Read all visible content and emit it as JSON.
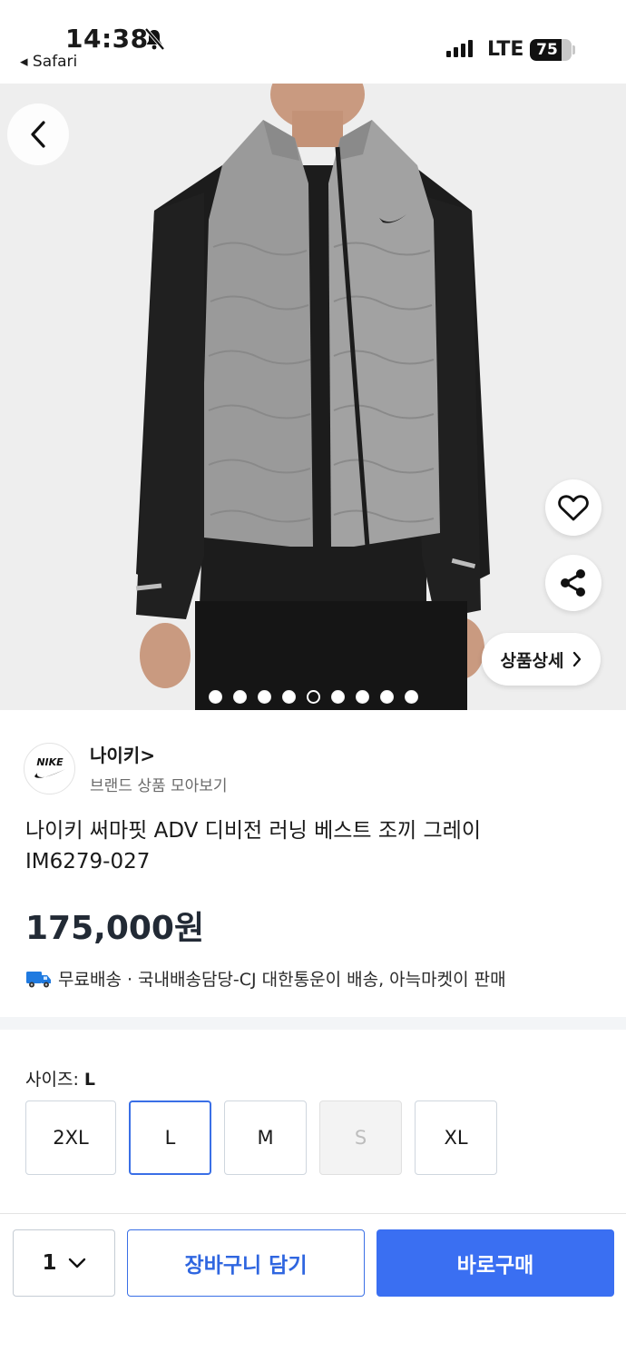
{
  "status_bar": {
    "time": "14:38",
    "back_app": "◂ Safari",
    "network": "LTE",
    "battery": "75",
    "battery_level": 0.75
  },
  "hero": {
    "image_count": 9,
    "active_index": 4,
    "detail_label": "상품상세",
    "icons": {
      "back": "chevron-left-icon",
      "like": "heart-icon",
      "share": "share-icon"
    }
  },
  "brand": {
    "name": "나이키>",
    "subtitle": "브랜드 상품 모아보기",
    "logo_text": "NIKE"
  },
  "product": {
    "title_line1": "나이키 써마핏 ADV 디비전 러닝 베스트 조끼 그레이",
    "title_line2": "IM6279-027",
    "price": "175,000원",
    "shipping_icon": "truck-icon",
    "shipping": "무료배송 · 국내배송담당-CJ 대한통운이 배송, 아늑마켓이 판매"
  },
  "size": {
    "label": "사이즈:",
    "selected": "L",
    "options": [
      {
        "label": "2XL",
        "state": "normal"
      },
      {
        "label": "L",
        "state": "selected"
      },
      {
        "label": "M",
        "state": "normal"
      },
      {
        "label": "S",
        "state": "disabled"
      },
      {
        "label": "XL",
        "state": "normal"
      }
    ]
  },
  "bottom_bar": {
    "quantity": "1",
    "cart_label": "장바구니 담기",
    "buy_label": "바로구매"
  },
  "colors": {
    "accent": "#3a6ff2",
    "price_text": "#222a35",
    "shipping_truck": "#1f7ae0"
  }
}
